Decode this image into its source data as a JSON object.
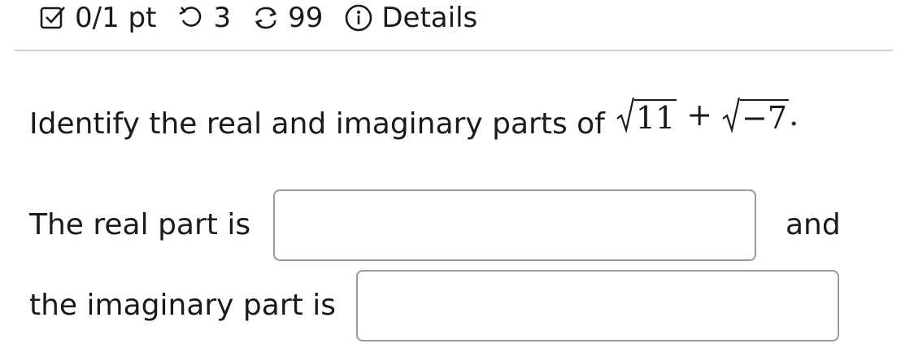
{
  "header": {
    "score": "0/1 pt",
    "retries": "3",
    "submissions": "99",
    "details": "Details",
    "icons": [
      "checkbox-icon",
      "retry-icon",
      "refresh-icon",
      "info-icon"
    ]
  },
  "question": {
    "text": "Identify the real and imaginary parts of",
    "radicand_1": "11",
    "plus": "+",
    "radicand_2": "−7",
    "period": "."
  },
  "answers": {
    "real_label": "The real part is",
    "real_value": "",
    "and_text": "and",
    "imag_label": "the imaginary part is",
    "imag_value": ""
  },
  "colors": {
    "text": "#1a1a1a",
    "border": "#9a9a9a",
    "rule": "#cfcfcf"
  }
}
